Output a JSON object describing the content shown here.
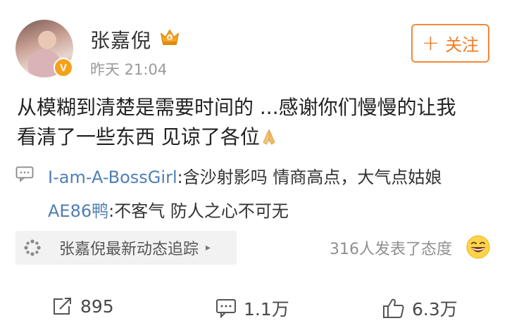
{
  "post": {
    "username": "张嘉倪",
    "timestamp": "昨天 21:04",
    "verified_badge": "V",
    "vip_icon": "crown-icon",
    "follow_label": "关注",
    "follow_plus": "+",
    "text_line1": "从模糊到清楚是需要时间的 ...感谢你们慢慢的让我",
    "text_line2": "看清了一些东西 见谅了各位",
    "text_emoji": "praying-hands-emoji"
  },
  "comments": [
    {
      "user": "I-am-A-BossGirl",
      "text": ":含沙射影吗  情商高点，大气点姑娘"
    },
    {
      "user": "AE86鸭",
      "text": ":不客气 防人之心不可无"
    }
  ],
  "tracker": {
    "label": "张嘉倪最新动态追踪",
    "arrow": "▸"
  },
  "reactions": {
    "text": "316人发表了态度",
    "emoji": "laughing-emoji"
  },
  "actions": {
    "repost_count": "895",
    "comment_count": "1.1万",
    "like_count": "6.3万"
  },
  "colors": {
    "accent": "#f27a22",
    "link": "#4f7fb5",
    "muted": "#9a9a9a"
  }
}
